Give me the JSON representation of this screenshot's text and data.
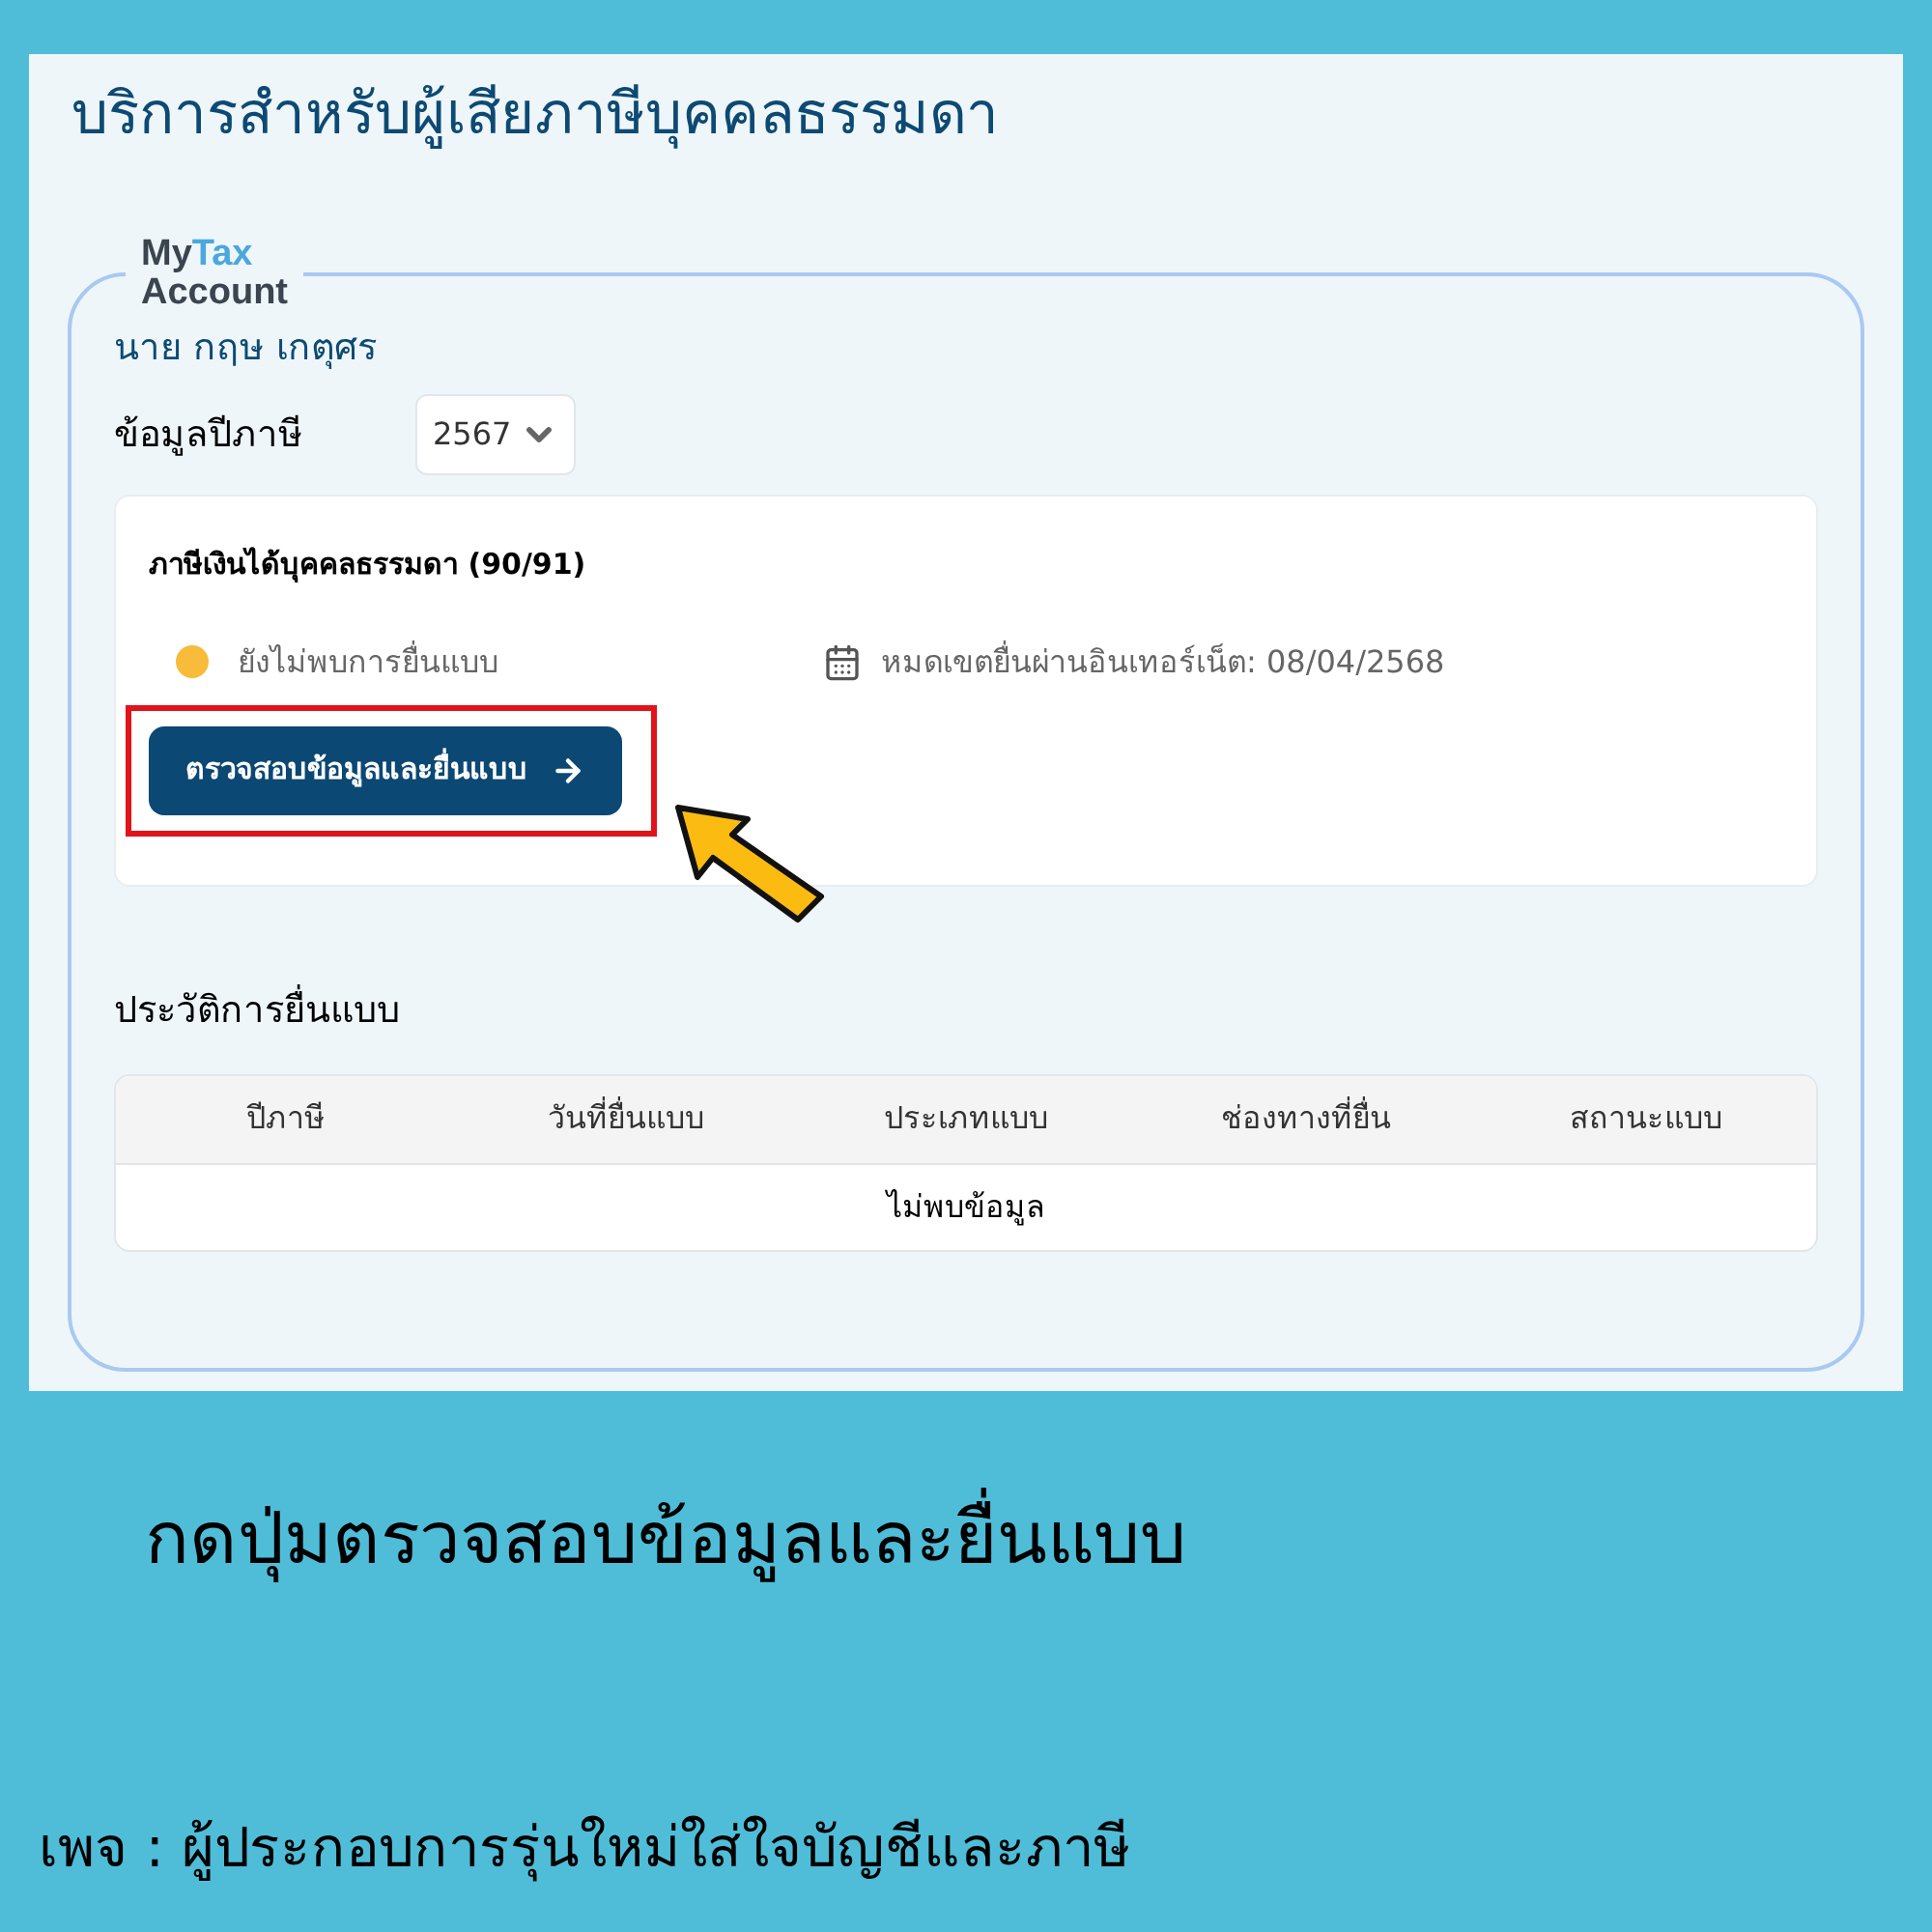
{
  "page": {
    "title": "บริการสำหรับผู้เสียภาษีบุคคลธรรมดา"
  },
  "account": {
    "logo": [
      {
        "text": "My",
        "accent": false
      },
      {
        "text": "Tax",
        "accent": true
      }
    ],
    "logo_line2": "Account",
    "name": "นาย กฤษ เกตุศร",
    "year_label": "ข้อมูลปีภาษี",
    "year_select": {
      "value": "2567"
    }
  },
  "filing": {
    "title": "ภาษีเงินได้บุคคลธรรมดา (90/91)",
    "status": {
      "text": "ยังไม่พบการยื่นแบบ",
      "color": "#f8bb3a"
    },
    "deadline": "หมดเขตยื่นผ่านอินเทอร์เน็ต: 08/04/2568",
    "button": {
      "label": "ตรวจสอบข้อมูลและยื่นแบบ",
      "highlighted": true
    }
  },
  "history": {
    "heading": "ประวัติการยื่นแบบ",
    "columns": [
      "ปีภาษี",
      "วันที่ยื่นแบบ",
      "ประเภทแบบ",
      "ช่องทางที่ยื่น",
      "สถานะแบบ"
    ],
    "empty": "ไม่พบข้อมูล"
  },
  "caption": "กดปุ่มตรวจสอบข้อมูลและยื่นแบบ",
  "footer": "เพจ : ผู้ประกอบการรุ่นใหม่ใส่ใจบัญชีและภาษี"
}
